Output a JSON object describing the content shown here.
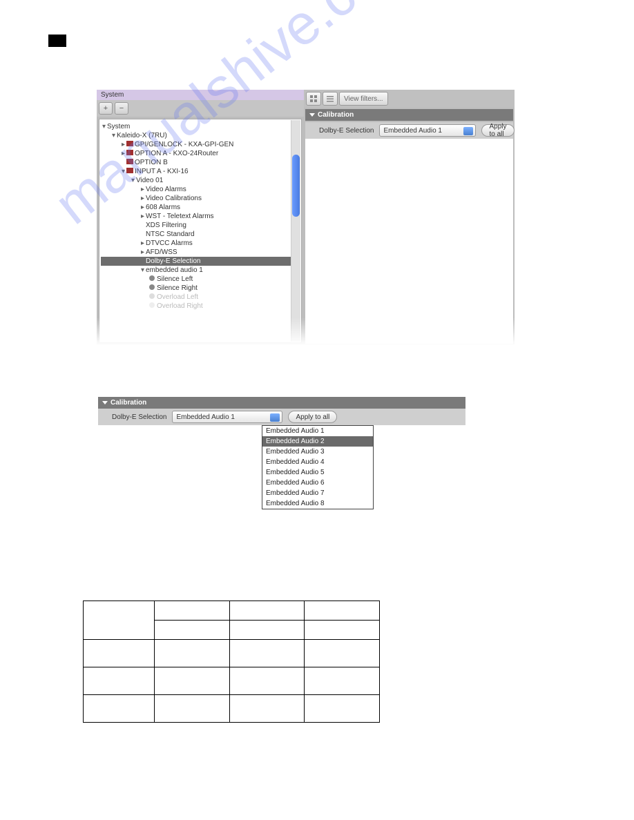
{
  "left": {
    "title": "System",
    "tree": {
      "root": "System",
      "kaleido": "Kaleido-X (7RU)",
      "gpi": "GPI/GENLOCK - KXA-GPI-GEN",
      "optionA": "OPTION A - KXO-24Router",
      "optionB": "OPTION B",
      "inputA": "INPUT A - KXI-16",
      "video": "Video  01",
      "videoAlarms": "Video Alarms",
      "videoCalibrations": "Video Calibrations",
      "alarms608": "608 Alarms",
      "wst": "WST - Teletext Alarms",
      "xds": "XDS Filtering",
      "ntsc": "NTSC Standard",
      "dtvcc": "DTVCC Alarms",
      "afd": "AFD/WSS",
      "dolby": "Dolby-E Selection",
      "embedded": "embedded audio 1",
      "silenceL": "Silence Left",
      "silenceR": "Silence Right",
      "overloadL": "Overload Left",
      "overloadR": "Overload Right"
    }
  },
  "toolbar": {
    "viewFilters": "View filters..."
  },
  "calibration": {
    "header": "Calibration",
    "label": "Dolby-E Selection",
    "selected": "Embedded Audio 1",
    "applyAll": "Apply to all"
  },
  "dropdown": {
    "options": [
      "Embedded Audio 1",
      "Embedded Audio 2",
      "Embedded Audio 3",
      "Embedded Audio 4",
      "Embedded Audio 5",
      "Embedded Audio 6",
      "Embedded Audio 7",
      "Embedded Audio 8"
    ],
    "hoverIndex": 1
  },
  "watermark": "manualshive.com"
}
